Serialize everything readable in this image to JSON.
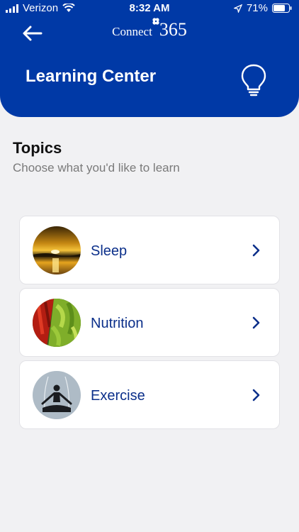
{
  "status_bar": {
    "carrier": "Verizon",
    "time": "8:32 AM",
    "battery": "71%"
  },
  "header": {
    "logo_word": "Connect",
    "logo_number": "365",
    "title": "Learning Center"
  },
  "topics": {
    "title": "Topics",
    "subtitle": "Choose what you'd like to learn",
    "items": [
      {
        "label": "Sleep",
        "icon": "sunset-photo"
      },
      {
        "label": "Nutrition",
        "icon": "vegetables-photo"
      },
      {
        "label": "Exercise",
        "icon": "yoga-silhouette-photo"
      }
    ]
  },
  "colors": {
    "brand_blue": "#0039a6",
    "label_blue": "#0b2f8a",
    "background": "#f1f1f3"
  }
}
